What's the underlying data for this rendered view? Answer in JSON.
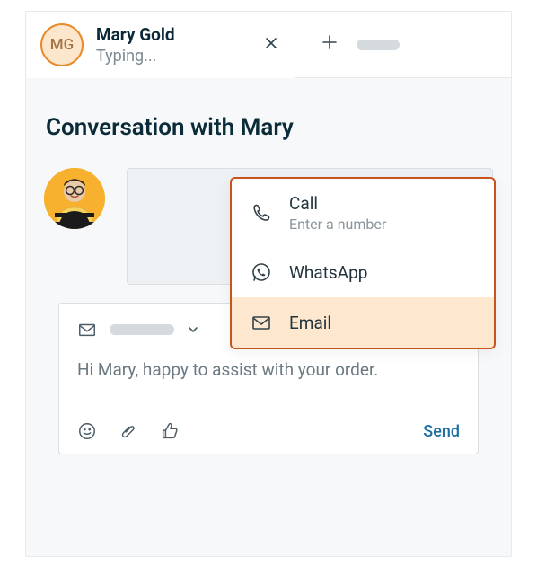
{
  "contact": {
    "initials": "MG",
    "name": "Mary Gold",
    "status": "Typing..."
  },
  "page": {
    "title": "Conversation with Mary"
  },
  "channel_menu": {
    "call": {
      "label": "Call",
      "subtitle": "Enter a number"
    },
    "whatsapp": {
      "label": "WhatsApp"
    },
    "email": {
      "label": "Email"
    }
  },
  "compose": {
    "message": "Hi Mary, happy to assist with your order.",
    "send_label": "Send"
  }
}
